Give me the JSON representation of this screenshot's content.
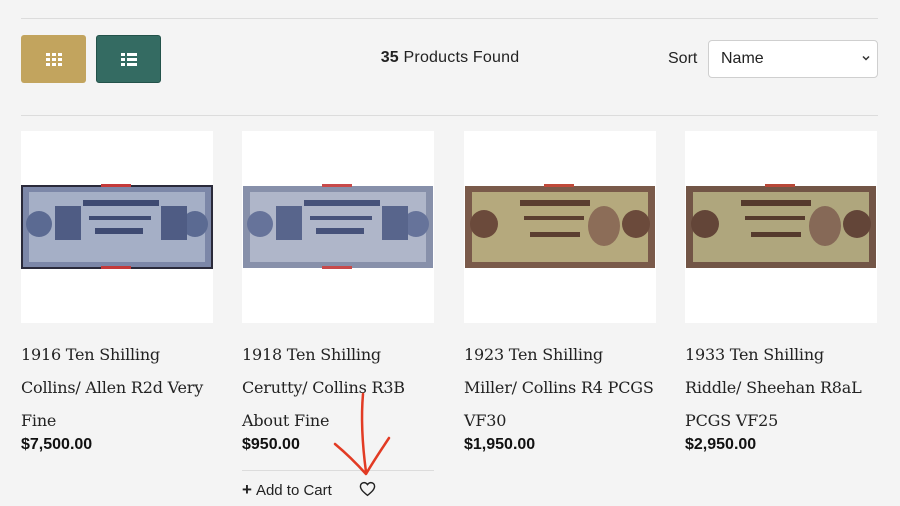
{
  "toolbar": {
    "count_number": "35",
    "count_label": "Products Found",
    "sort_label": "Sort",
    "sort_value": "Name"
  },
  "products": [
    {
      "title": "1916 Ten Shilling Collins/ Allen R2d Very Fine",
      "price": "$7,500.00"
    },
    {
      "title": "1918 Ten Shilling Cerutty/ Collins R3B About Fine",
      "price": "$950.00"
    },
    {
      "title": "1923 Ten Shilling Miller/ Collins R4 PCGS VF30",
      "price": "$1,950.00"
    },
    {
      "title": "1933 Ten Shilling Riddle/ Sheehan R8aL PCGS VF25",
      "price": "$2,950.00"
    }
  ],
  "actions": {
    "add_to_cart": "Add to Cart"
  },
  "colors": {
    "grid_button": "#c2a45e",
    "list_button": "#346b62",
    "annotation_arrow": "#e23b24"
  }
}
